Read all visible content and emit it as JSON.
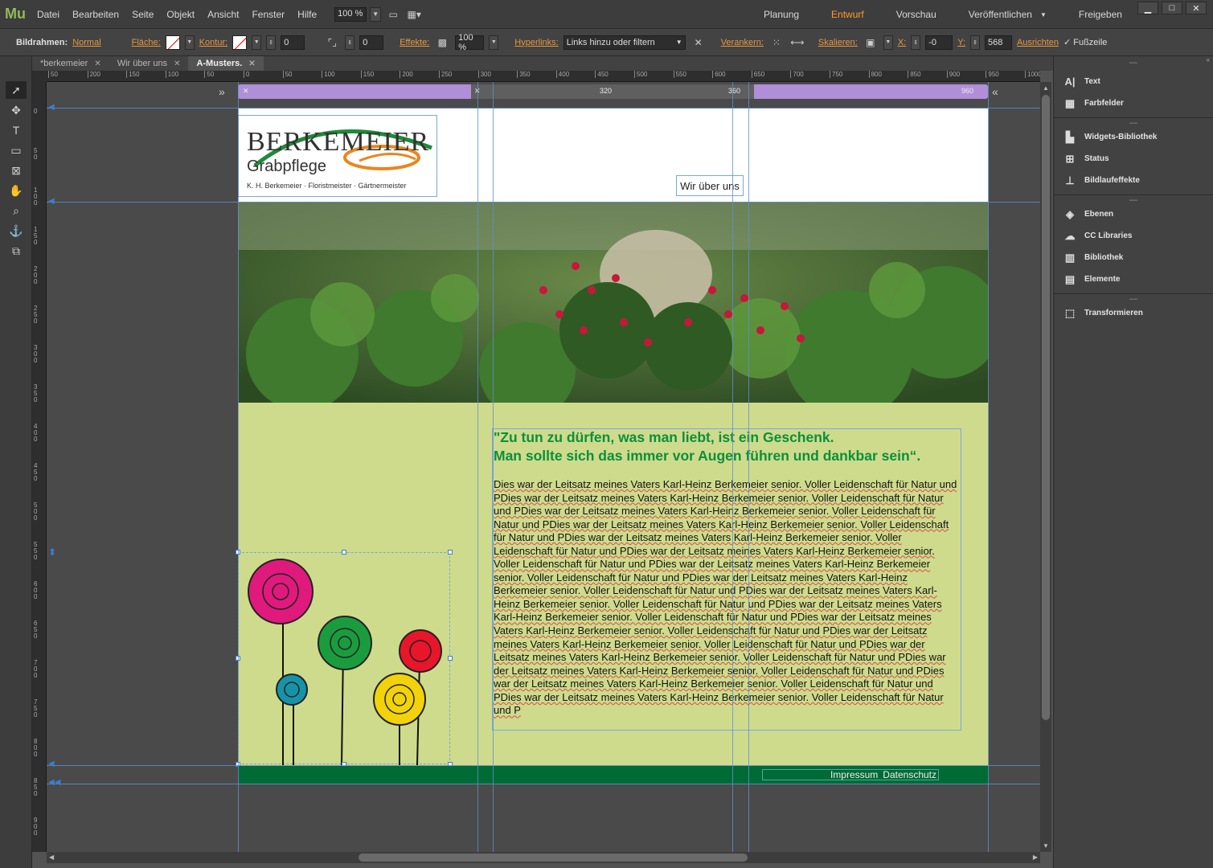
{
  "app": {
    "logo": "Mu"
  },
  "menu": [
    "Datei",
    "Bearbeiten",
    "Seite",
    "Objekt",
    "Ansicht",
    "Fenster",
    "Hilfe"
  ],
  "zoom": "100 %",
  "modes": [
    {
      "label": "Planung",
      "active": false
    },
    {
      "label": "Entwurf",
      "active": true
    },
    {
      "label": "Vorschau",
      "active": false
    },
    {
      "label": "Veröffentlichen",
      "active": false
    },
    {
      "label": "Freigeben",
      "active": false
    }
  ],
  "control": {
    "frame_label": "Bildrahmen:",
    "frame_style": "Normal",
    "fill_label": "Fläche:",
    "stroke_label": "Kontur:",
    "stroke_value": "0",
    "corner_value": "0",
    "effects_label": "Effekte:",
    "opacity": "100 %",
    "hyperlinks_label": "Hyperlinks:",
    "hyperlinks_placeholder": "Links hinzu oder filtern",
    "anchor_label": "Verankern:",
    "scale_label": "Skalieren:",
    "x_label": "X:",
    "x_value": "-0",
    "y_label": "Y:",
    "y_value": "568",
    "align_label": "Ausrichten",
    "footer_check": "Fußzeile"
  },
  "tabs": [
    {
      "label": "*berkemeier",
      "active": false
    },
    {
      "label": "Wir über uns",
      "active": false
    },
    {
      "label": "A-Musters.",
      "active": true
    }
  ],
  "breakpoints": {
    "min": "320",
    "mid": "360",
    "max": "960"
  },
  "page": {
    "logo_big": "BERKEMEIER",
    "logo_sub": "Grabpflege",
    "logo_small": "K. H. Berkemeier · Floristmeister · Gärtnermeister",
    "nav_link": "Wir über uns",
    "quote_line1": "\"Zu tun zu dürfen, was man liebt, ist ein Geschenk.",
    "quote_line2": "Man sollte sich das immer vor Augen führen und dankbar sein“.",
    "body": "Dies war der Leitsatz meines Vaters Karl-Heinz Berkemeier senior. Voller Leidenschaft für Natur und PDies war der Leitsatz meines Vaters Karl-Heinz Berkemeier senior. Voller Leidenschaft für Natur und PDies war der Leitsatz meines Vaters Karl-Heinz Berkemeier senior. Voller Leidenschaft für Natur und PDies war der Leitsatz meines Vaters Karl-Heinz Berkemeier senior. Voller Leidenschaft für Natur und PDies war der Leitsatz meines Vaters Karl-Heinz Berkemeier senior. Voller Leidenschaft für Natur und PDies war der Leitsatz meines Vaters Karl-Heinz Berkemeier senior. Voller Leidenschaft für Natur und PDies war der Leitsatz meines Vaters Karl-Heinz Berkemeier senior. Voller Leidenschaft für Natur und PDies war der Leitsatz meines Vaters Karl-Heinz Berkemeier senior. Voller Leidenschaft für Natur und PDies war der Leitsatz meines Vaters Karl-Heinz Berkemeier senior. Voller Leidenschaft für Natur und PDies war der Leitsatz meines Vaters Karl-Heinz Berkemeier senior. Voller Leidenschaft für Natur und PDies war der Leitsatz meines Vaters Karl-Heinz Berkemeier senior. Voller Leidenschaft für Natur und PDies war der Leitsatz meines Vaters Karl-Heinz Berkemeier senior. Voller Leidenschaft für Natur und PDies war der Leitsatz meines Vaters Karl-Heinz Berkemeier senior. Voller Leidenschaft für Natur und PDies war der Leitsatz meines Vaters Karl-Heinz Berkemeier senior. Voller Leidenschaft für Natur und PDies war der Leitsatz meines Vaters Karl-Heinz Berkemeier senior. Voller Leidenschaft für Natur und PDies war der Leitsatz meines Vaters Karl-Heinz Berkemeier senior. Voller Leidenschaft für Natur und P",
    "footer_impressum": "Impressum",
    "footer_datenschutz": "Datenschutz"
  },
  "hruler_labels": [
    "50",
    "200",
    "150",
    "100",
    "50",
    "0",
    "50",
    "100",
    "150",
    "200",
    "250",
    "300",
    "350",
    "400",
    "450",
    "500",
    "550",
    "600",
    "650",
    "700",
    "750",
    "800",
    "850",
    "900",
    "950",
    "1000"
  ],
  "vruler_labels": [
    "0",
    "50",
    "100",
    "150",
    "200",
    "250",
    "300",
    "350",
    "400",
    "450",
    "500",
    "550",
    "600",
    "650",
    "700",
    "750",
    "800",
    "850",
    "900"
  ],
  "panels": [
    {
      "label": "Text",
      "icon": "text-icon"
    },
    {
      "label": "Farbfelder",
      "icon": "swatches-icon"
    },
    {
      "label": "Widgets-Bibliothek",
      "icon": "widgets-icon"
    },
    {
      "label": "Status",
      "icon": "status-icon"
    },
    {
      "label": "Bildlaufeffekte",
      "icon": "scroll-effects-icon"
    },
    {
      "label": "Ebenen",
      "icon": "layers-icon"
    },
    {
      "label": "CC Libraries",
      "icon": "cc-libraries-icon"
    },
    {
      "label": "Bibliothek",
      "icon": "library-icon"
    },
    {
      "label": "Elemente",
      "icon": "assets-icon"
    },
    {
      "label": "Transformieren",
      "icon": "transform-icon"
    }
  ],
  "colors": {
    "accent": "#ff9a2e",
    "page_green": "#cedb8c",
    "footer_green": "#006b35",
    "quote_green": "#0b8f3c"
  }
}
